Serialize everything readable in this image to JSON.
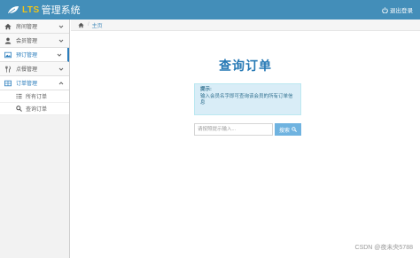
{
  "header": {
    "brand_prefix": "LTS",
    "title": "管理系统",
    "logout_label": "退出登录"
  },
  "sidebar": {
    "items": [
      {
        "label": "房间管理",
        "icon": "home-icon"
      },
      {
        "label": "会员管理",
        "icon": "user-icon"
      },
      {
        "label": "预订管理",
        "icon": "picture-icon"
      },
      {
        "label": "点餐管理",
        "icon": "cutlery-icon"
      },
      {
        "label": "订单管理",
        "icon": "grid-icon"
      }
    ],
    "subitems": [
      {
        "label": "所有订单",
        "icon": "list-icon"
      },
      {
        "label": "查询订单",
        "icon": "search-icon"
      }
    ]
  },
  "breadcrumb": {
    "home_label": "主页"
  },
  "main": {
    "title": "查询订单",
    "hint_title": "提示:",
    "hint_text": "输入会员名字即可查询该会员的所有订单信息",
    "search_placeholder": "请按照提示输入...",
    "search_button": "搜索"
  },
  "watermark": "CSDN @夜未央5788",
  "colors": {
    "topbar": "#438eb9",
    "accent": "#2b7dbc",
    "hint_bg": "#d9edf7",
    "button": "#6fb3e0"
  }
}
